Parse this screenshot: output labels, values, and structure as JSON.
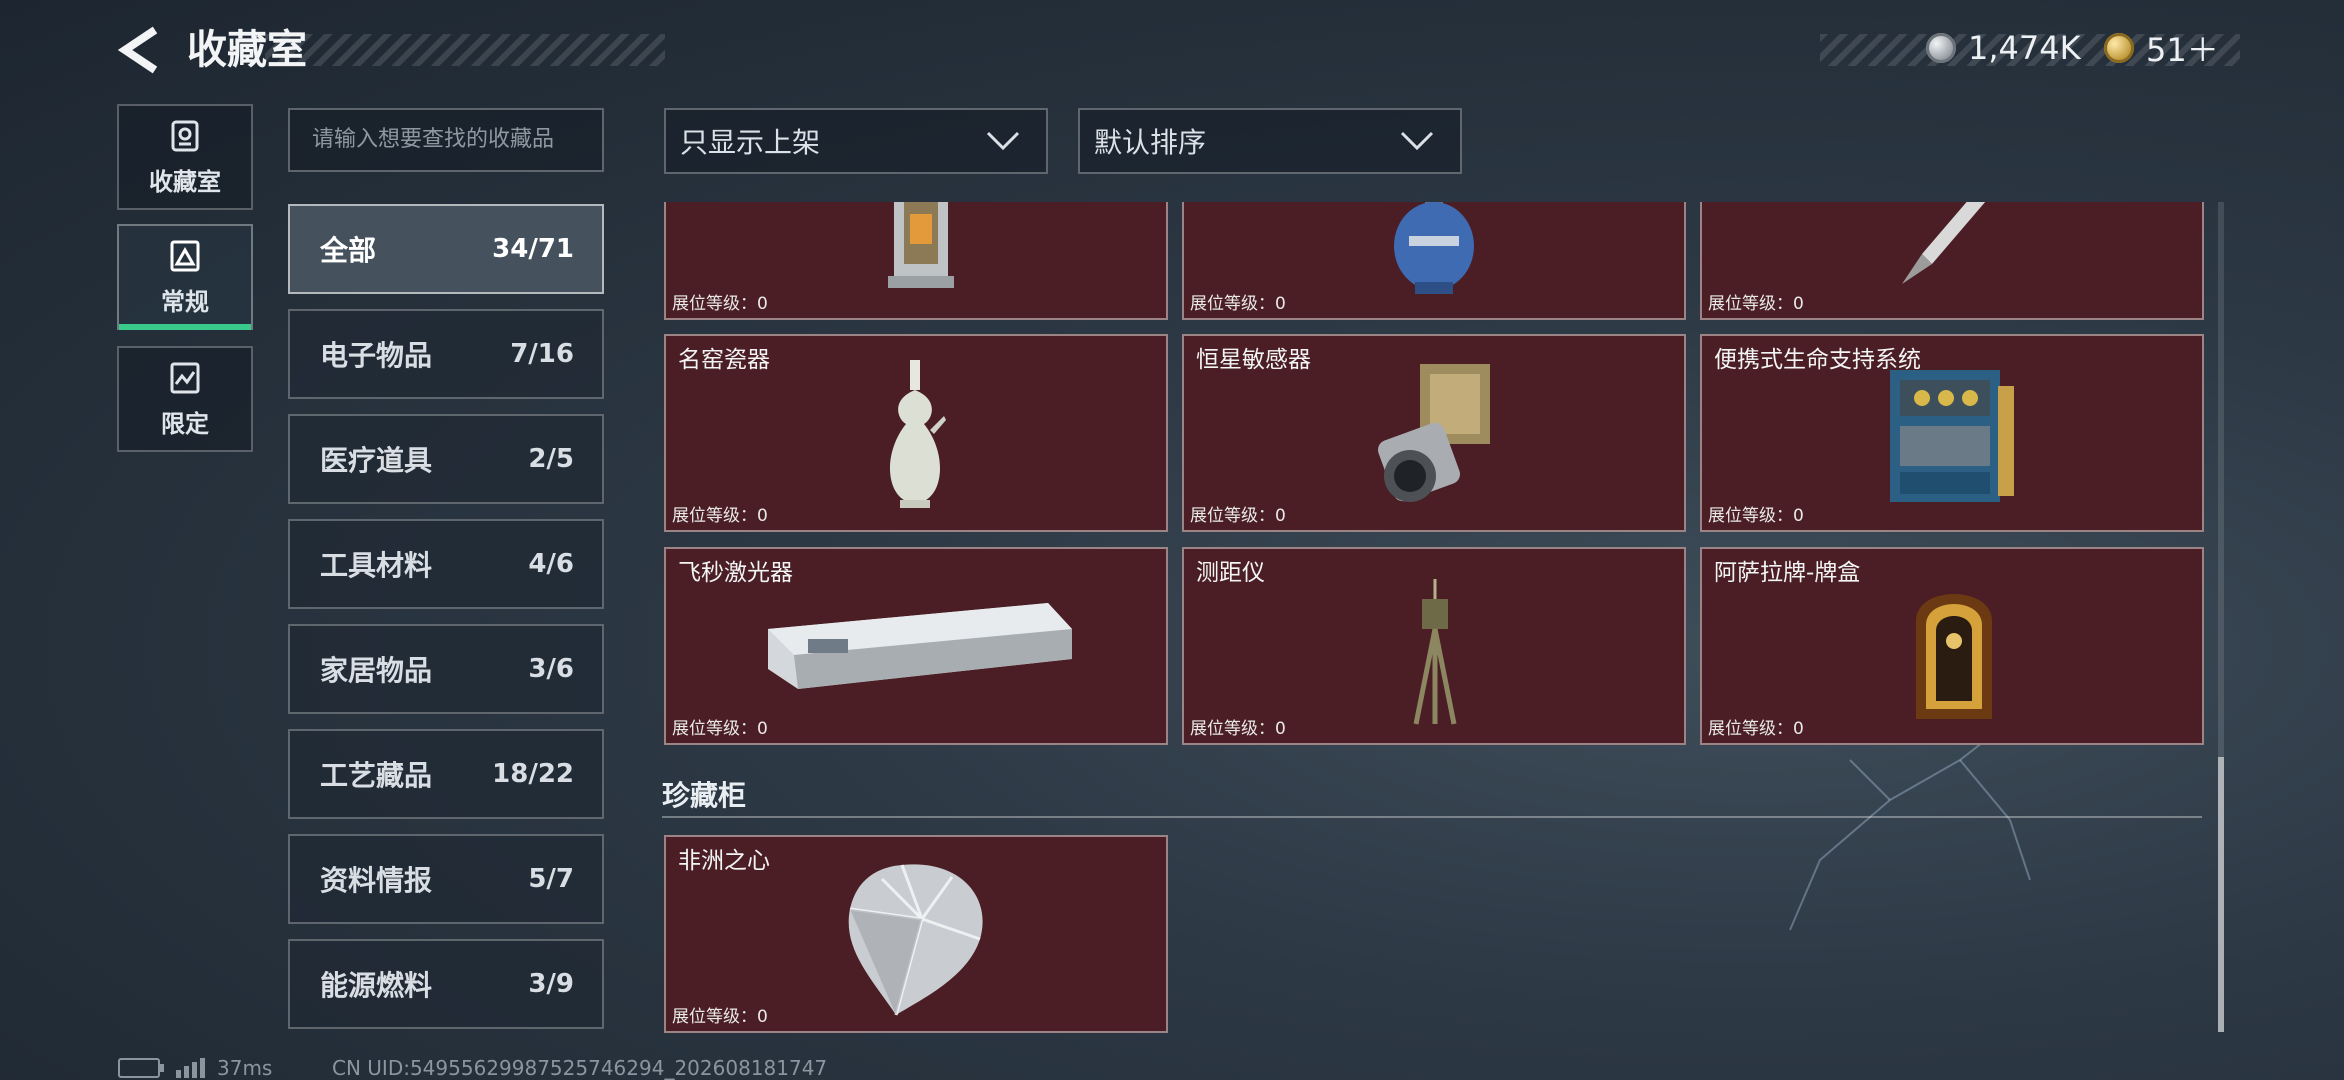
{
  "header": {
    "title": "收藏室"
  },
  "currency": {
    "silver": "1,474K",
    "gold": "51＋"
  },
  "rail": [
    {
      "label": "收藏室",
      "icon": "vault-icon"
    },
    {
      "label": "常规",
      "icon": "regular-collection-icon",
      "active": true
    },
    {
      "label": "限定",
      "icon": "limited-collection-icon"
    }
  ],
  "search": {
    "placeholder": "请输入想要查找的收藏品"
  },
  "categories": [
    {
      "name": "全部",
      "count": "34/71",
      "active": true
    },
    {
      "name": "电子物品",
      "count": "7/16"
    },
    {
      "name": "医疗道具",
      "count": "2/5"
    },
    {
      "name": "工具材料",
      "count": "4/6"
    },
    {
      "name": "家居物品",
      "count": "3/6"
    },
    {
      "name": "工艺藏品",
      "count": "18/22"
    },
    {
      "name": "资料情报",
      "count": "5/7"
    },
    {
      "name": "能源燃料",
      "count": "3/9"
    }
  ],
  "filters": {
    "show": "只显示上架",
    "sort": "默认排序"
  },
  "items": [
    {
      "name": "",
      "level": "展位等级：0",
      "icon": "lantern-icon"
    },
    {
      "name": "",
      "level": "展位等级：0",
      "icon": "gas-tank-icon"
    },
    {
      "name": "",
      "level": "展位等级：0",
      "icon": "fountain-pen-icon"
    },
    {
      "name": "名窑瓷器",
      "level": "展位等级：0",
      "icon": "porcelain-vase-icon"
    },
    {
      "name": "恒星敏感器",
      "level": "展位等级：0",
      "icon": "star-sensor-icon"
    },
    {
      "name": "便携式生命支持系统",
      "level": "展位等级：0",
      "icon": "life-support-icon"
    },
    {
      "name": "飞秒激光器",
      "level": "展位等级：0",
      "icon": "laser-device-icon"
    },
    {
      "name": "测距仪",
      "level": "展位等级：0",
      "icon": "rangefinder-tripod-icon"
    },
    {
      "name": "阿萨拉牌-牌盒",
      "level": "展位等级：0",
      "icon": "card-box-icon"
    }
  ],
  "treasure_section": {
    "title": "珍藏柜",
    "items": [
      {
        "name": "非洲之心",
        "level": "展位等级：0",
        "icon": "diamond-icon"
      }
    ]
  },
  "status": {
    "ping": "37ms",
    "uid": "CN UID:549556299875257462​94_202608181747"
  },
  "colors": {
    "accent": "#39c98b",
    "card_bg": "#4a1e24"
  }
}
